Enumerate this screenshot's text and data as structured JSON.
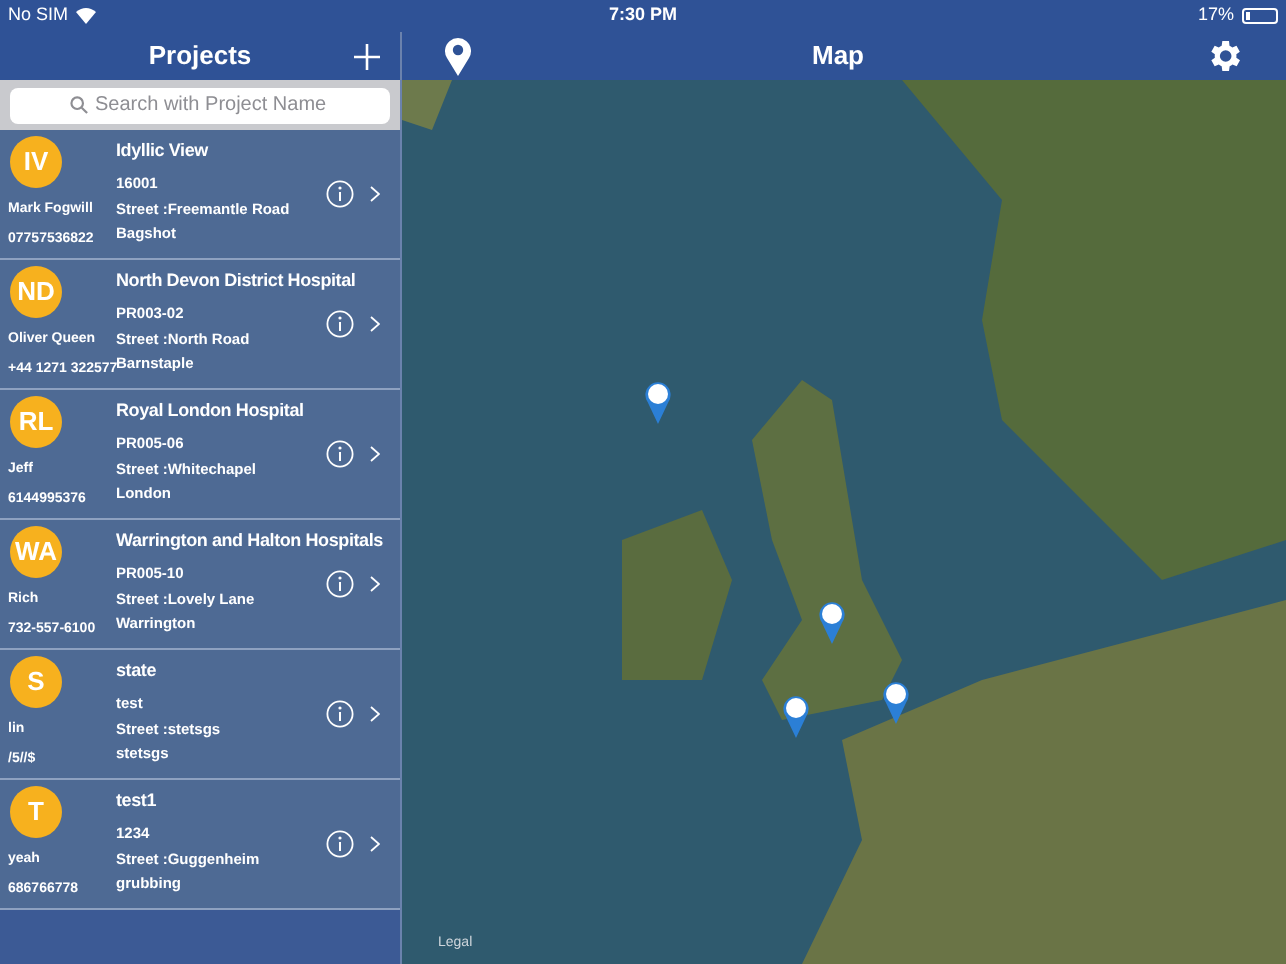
{
  "status_bar": {
    "carrier": "No SIM",
    "time": "7:30 PM",
    "battery": "17%"
  },
  "sidebar": {
    "title": "Projects",
    "search": {
      "placeholder": "Search with Project Name"
    },
    "projects": [
      {
        "initials": "IV",
        "contact": "Mark Fogwill",
        "phone": "07757536822",
        "name": "Idyllic View",
        "code": "16001",
        "street": "Street :Freemantle Road",
        "city": "Bagshot"
      },
      {
        "initials": "ND",
        "contact": "Oliver Queen",
        "phone": "+44 1271 322577",
        "name": "North Devon District Hospital",
        "code": "PR003-02",
        "street": "Street :North Road",
        "city": "Barnstaple"
      },
      {
        "initials": "RL",
        "contact": "Jeff",
        "phone": "6144995376",
        "name": "Royal London Hospital",
        "code": "PR005-06",
        "street": "Street :Whitechapel",
        "city": "London"
      },
      {
        "initials": "WA",
        "contact": "Rich",
        "phone": "732-557-6100",
        "name": "Warrington and Halton Hospitals",
        "code": "PR005-10",
        "street": "Street :Lovely Lane",
        "city": "Warrington"
      },
      {
        "initials": "S",
        "contact": "lin",
        "phone": "/5//$",
        "name": "state",
        "code": "test",
        "street": "Street :stetsgs",
        "city": "stetsgs"
      },
      {
        "initials": "T",
        "contact": "yeah",
        "phone": "686766778",
        "name": "test1",
        "code": "1234",
        "street": "Street :Guggenheim",
        "city": "grubbing"
      }
    ]
  },
  "map": {
    "title": "Map",
    "legal": "Legal"
  }
}
